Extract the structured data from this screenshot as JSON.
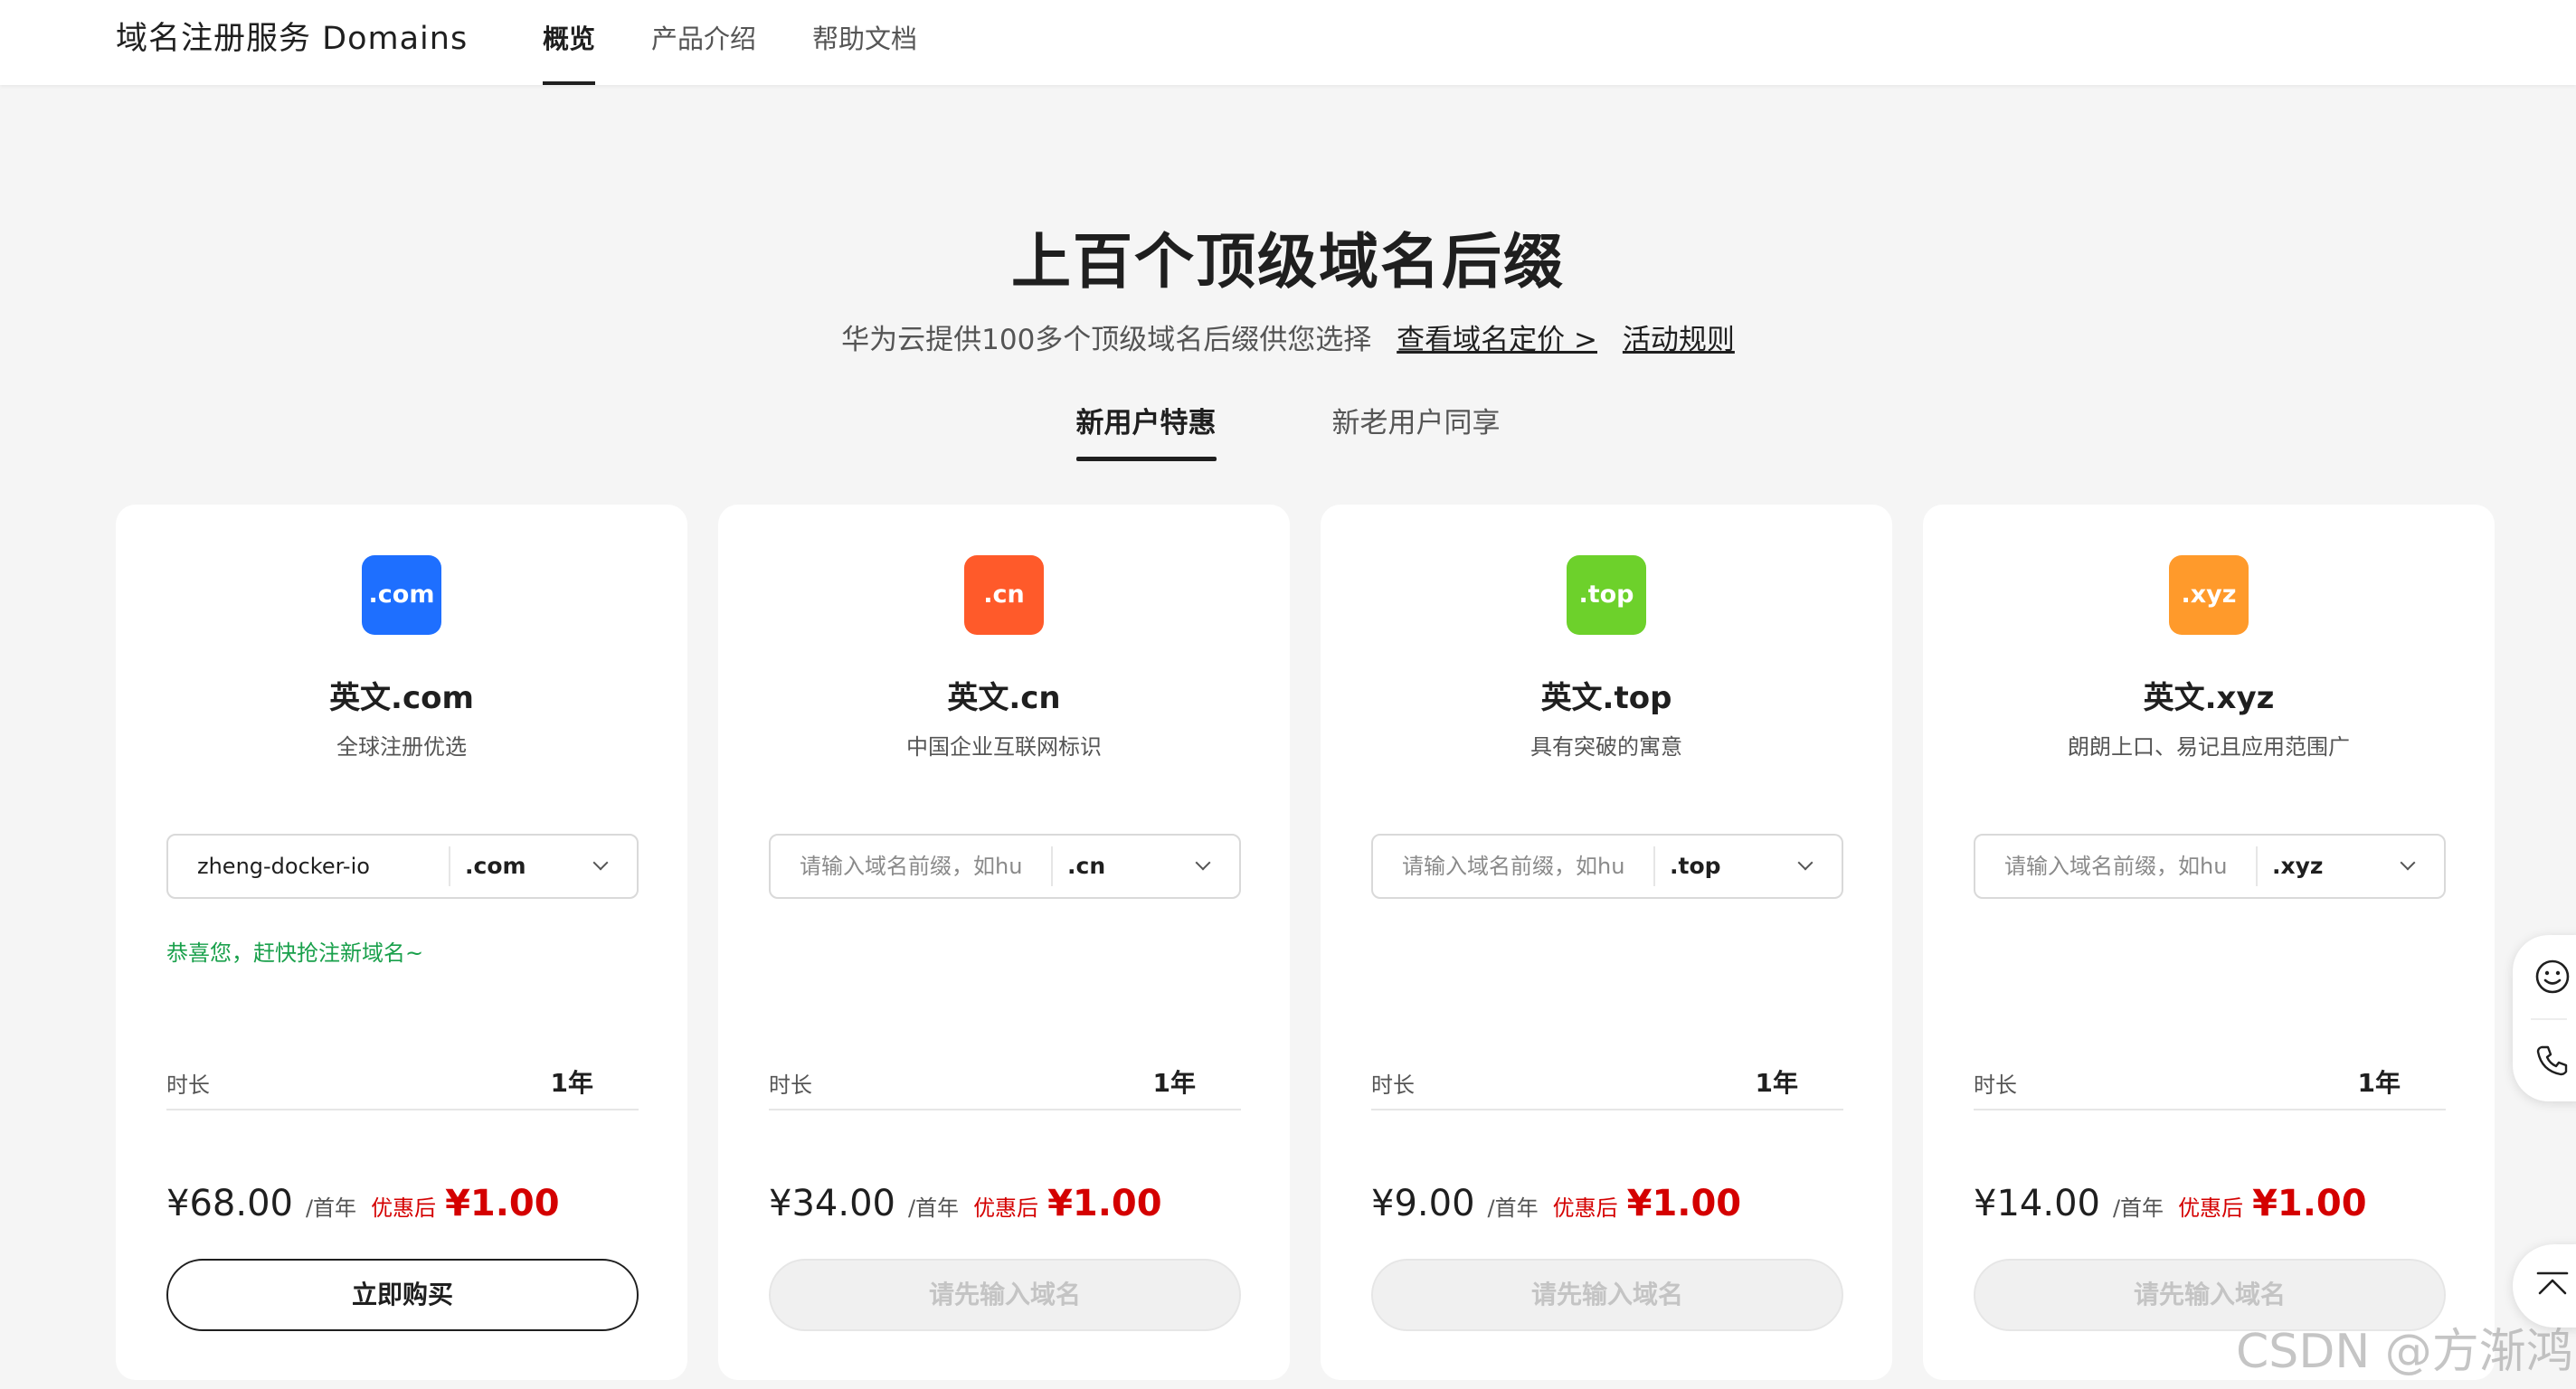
{
  "header": {
    "brand": "域名注册服务 Domains",
    "nav": [
      "概览",
      "产品介绍",
      "帮助文档"
    ]
  },
  "hero": {
    "title": "上百个顶级域名后缀",
    "subtitle": "华为云提供100多个顶级域名后缀供您选择",
    "link_pricing": "查看域名定价 >",
    "link_rules": "活动规则"
  },
  "tabs": [
    "新用户特惠",
    "新老用户同享"
  ],
  "colors": {
    "com": "#1e6fff",
    "cn": "#ff5a2a",
    "top": "#6dd12b",
    "xyz": "#ff9a2b",
    "red": "#d40000",
    "green": "#19a04b"
  },
  "cards": [
    {
      "badge": ".com",
      "title": "英文.com",
      "desc": "全球注册优选",
      "input_value": "zheng-docker-io",
      "placeholder": "请输入域名前缀，如hu",
      "suffix": ".com",
      "congrats": "恭喜您，赶快抢注新域名~",
      "duration_label": "时长",
      "duration_value": "1年",
      "price_orig": "¥68.00",
      "price_unit": "/首年",
      "price_after_label": "优惠后",
      "price_final": "¥1.00",
      "button": "立即购买"
    },
    {
      "badge": ".cn",
      "title": "英文.cn",
      "desc": "中国企业互联网标识",
      "input_value": "",
      "placeholder": "请输入域名前缀，如hu",
      "suffix": ".cn",
      "congrats": "",
      "duration_label": "时长",
      "duration_value": "1年",
      "price_orig": "¥34.00",
      "price_unit": "/首年",
      "price_after_label": "优惠后",
      "price_final": "¥1.00",
      "button": "请先输入域名"
    },
    {
      "badge": ".top",
      "title": "英文.top",
      "desc": "具有突破的寓意",
      "input_value": "",
      "placeholder": "请输入域名前缀，如hu",
      "suffix": ".top",
      "congrats": "",
      "duration_label": "时长",
      "duration_value": "1年",
      "price_orig": "¥9.00",
      "price_unit": "/首年",
      "price_after_label": "优惠后",
      "price_final": "¥1.00",
      "button": "请先输入域名"
    },
    {
      "badge": ".xyz",
      "title": "英文.xyz",
      "desc": "朗朗上口、易记且应用范围广",
      "input_value": "",
      "placeholder": "请输入域名前缀，如hu",
      "suffix": ".xyz",
      "congrats": "",
      "duration_label": "时长",
      "duration_value": "1年",
      "price_orig": "¥14.00",
      "price_unit": "/首年",
      "price_after_label": "优惠后",
      "price_final": "¥1.00",
      "button": "请先输入域名"
    }
  ],
  "watermark": "CSDN @方渐鸿"
}
